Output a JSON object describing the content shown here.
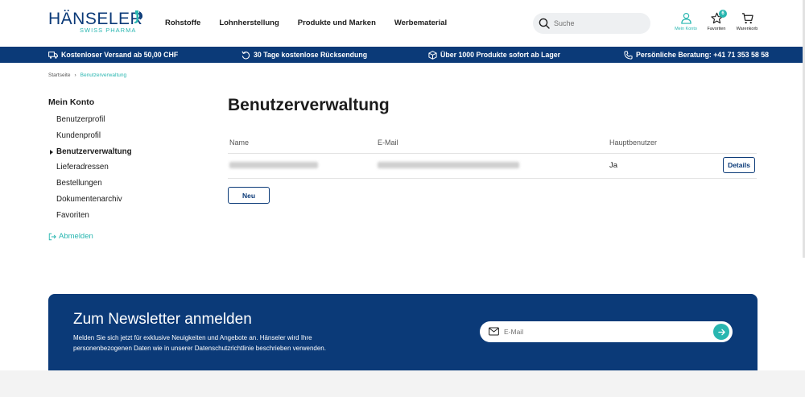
{
  "brand": {
    "name": "HÄNSELER",
    "tagline": "SWISS PHARMA",
    "primary_color": "#0b3a78",
    "accent_color": "#28b6b0"
  },
  "nav": {
    "items": [
      "Rohstoffe",
      "Lohnherstellung",
      "Produkte und Marken",
      "Werbematerial"
    ]
  },
  "search": {
    "placeholder": "Suche",
    "icon": "search-icon"
  },
  "header_actions": {
    "account": {
      "label": "Mein Konto",
      "icon": "user-icon"
    },
    "favorites": {
      "label": "Favoriten",
      "badge": "6",
      "icon": "star-icon"
    },
    "cart": {
      "label": "Warenkorb",
      "icon": "cart-icon"
    }
  },
  "infobar": {
    "shipping": "Kostenloser Versand ab 50,00 CHF",
    "returns": "30 Tage kostenlose Rücksendung",
    "products": "Über 1000 Produkte sofort ab Lager",
    "consulting": "Persönliche Beratung: +41 71 353 58 58"
  },
  "breadcrumb": {
    "home": "Startseite",
    "current": "Benutzerverwaltung"
  },
  "sidebar": {
    "title": "Mein Konto",
    "items": [
      {
        "label": "Benutzerprofil"
      },
      {
        "label": "Kundenprofil"
      },
      {
        "label": "Benutzerverwaltung",
        "active": true
      },
      {
        "label": "Lieferadressen"
      },
      {
        "label": "Bestellungen"
      },
      {
        "label": "Dokumentenarchiv"
      },
      {
        "label": "Favoriten"
      }
    ],
    "logout": "Abmelden"
  },
  "main": {
    "title": "Benutzerverwaltung",
    "table": {
      "headers": {
        "name": "Name",
        "email": "E-Mail",
        "main_user": "Hauptbenutzer"
      },
      "rows": [
        {
          "main_user": "Ja",
          "action": "Details"
        }
      ]
    },
    "new_button": "Neu"
  },
  "newsletter": {
    "title": "Zum Newsletter anmelden",
    "text": "Melden Sie sich jetzt für exklusive Neuigkeiten und Angebote an. Hänseler wird Ihre personenbezogenen Daten wie in unserer Datenschutzrichtlinie beschrieben verwenden.",
    "placeholder": "E-Mail"
  }
}
